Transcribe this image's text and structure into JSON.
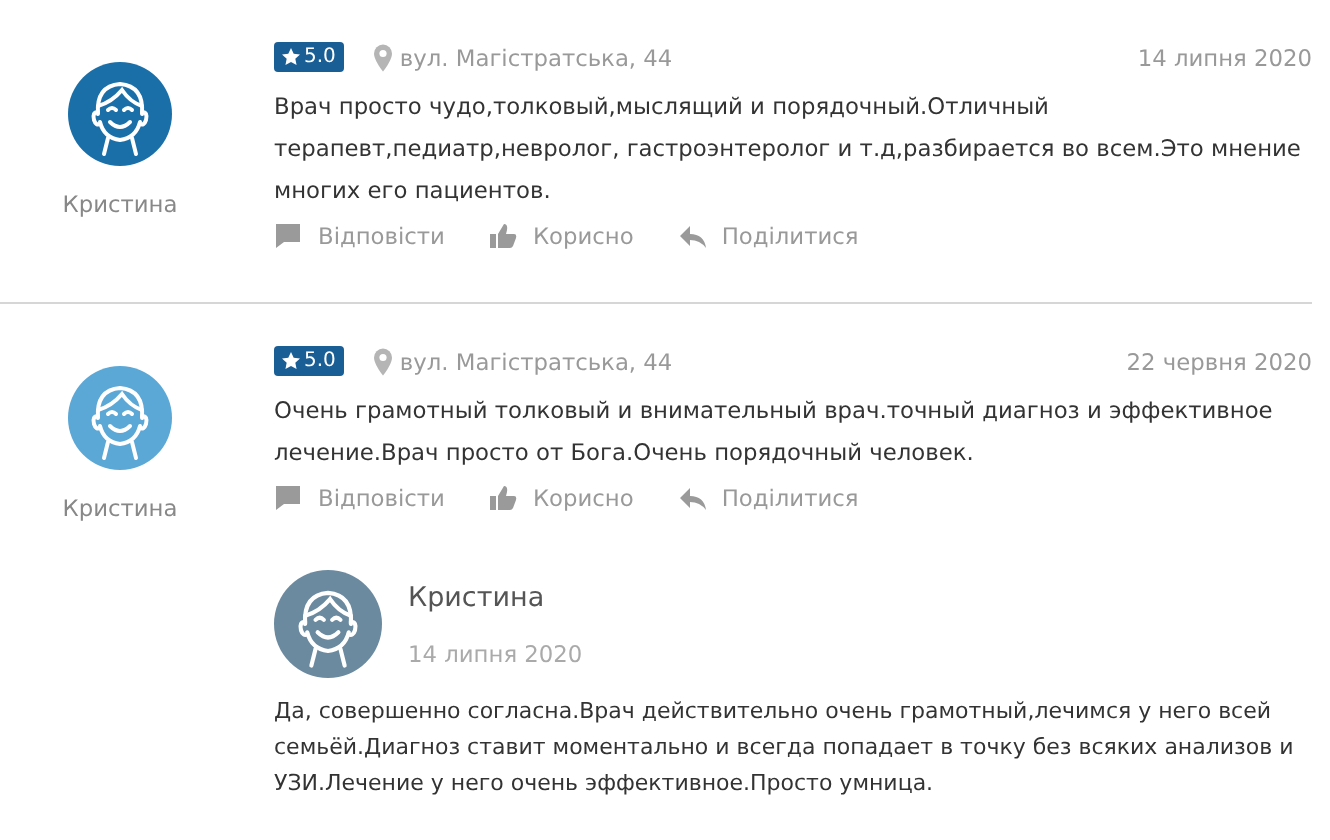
{
  "reviews": [
    {
      "author": "Кристина",
      "color": "#1a6fa8",
      "rating": "5.0",
      "address": "вул. Магістратська, 44",
      "date": "14 липня 2020",
      "text": "Врач просто чудо,толковый,мыслящий и порядочный.Отличный терапевт,педиатр,невролог, гастроэнтеролог и т.д,разбирается во всем.Это мнение многих его пациентов.",
      "actions": [
        {
          "kind": "reply",
          "label": "Відповісти"
        },
        {
          "kind": "like",
          "label": "Корисно"
        },
        {
          "kind": "share",
          "label": "Поділитися"
        }
      ]
    },
    {
      "author": "Кристина",
      "color": "#5ba7d6",
      "rating": "5.0",
      "address": "вул. Магістратська, 44",
      "date": "22 червня 2020",
      "text": "Очень грамотный толковый и внимательный врач.точный диагноз и эффективное лечение.Врач просто от Бога.Очень порядочный человек.",
      "actions": [
        {
          "kind": "reply",
          "label": "Відповісти"
        },
        {
          "kind": "like",
          "label": "Корисно"
        },
        {
          "kind": "share",
          "label": "Поділитися"
        }
      ],
      "reply": {
        "author": "Кристина",
        "color": "#6b8a9f",
        "date": "14 липня 2020",
        "text": "Да, совершенно согласна.Врач действительно очень грамотный,лечимся у него всей семьёй.Диагноз ставит моментально и всегда попадает в точку без всяких анализов и УЗИ.Лечение у него очень эффективное.Просто умница."
      }
    }
  ]
}
